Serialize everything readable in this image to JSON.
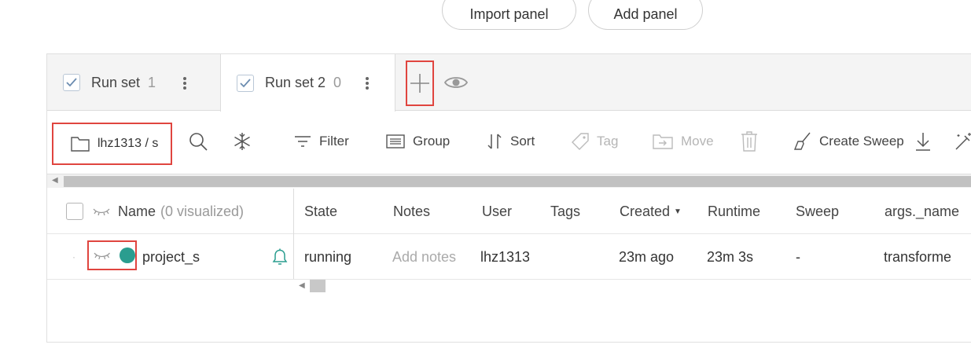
{
  "top_buttons": {
    "import": "Import panel",
    "add": "Add panel"
  },
  "tabs": [
    {
      "label": "Run set",
      "count": "1"
    },
    {
      "label": "Run set 2",
      "count": "0"
    }
  ],
  "toolbar": {
    "project": "lhz1313 / s",
    "filter": "Filter",
    "group": "Group",
    "sort": "Sort",
    "tag": "Tag",
    "move": "Move",
    "create_sweep": "Create Sweep"
  },
  "table": {
    "name_header": "Name",
    "name_header_sub": "(0 visualized)",
    "columns": [
      "State",
      "Notes",
      "User",
      "Tags",
      "Created",
      "Runtime",
      "Sweep",
      "args._name"
    ],
    "row": {
      "name": "project_s",
      "state": "running",
      "notes_placeholder": "Add notes",
      "user": "lhz1313",
      "tags": "",
      "created": "23m ago",
      "runtime": "23m 3s",
      "sweep": "-",
      "args_name": "transformer"
    }
  },
  "colors": {
    "accent_teal": "#2a9d8f",
    "highlight_red": "#e0453f",
    "check_blue": "#6b8cb0"
  }
}
